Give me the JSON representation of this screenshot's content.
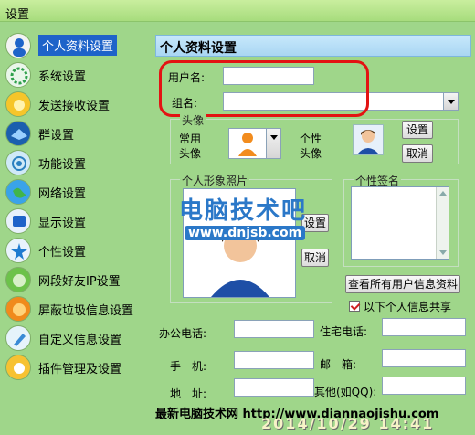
{
  "window": {
    "title": "设置"
  },
  "sidebar": {
    "items": [
      {
        "label": "个人资料设置",
        "icon": "person-icon",
        "active": true
      },
      {
        "label": "系统设置",
        "icon": "system-gear-icon"
      },
      {
        "label": "发送接收设置",
        "icon": "send-receive-icon"
      },
      {
        "label": "群设置",
        "icon": "group-icon"
      },
      {
        "label": "功能设置",
        "icon": "function-icon"
      },
      {
        "label": "网络设置",
        "icon": "globe-icon"
      },
      {
        "label": "显示设置",
        "icon": "display-icon"
      },
      {
        "label": "个性设置",
        "icon": "personality-icon"
      },
      {
        "label": "网段好友IP设置",
        "icon": "network-friends-icon"
      },
      {
        "label": "屏蔽垃圾信息设置",
        "icon": "block-spam-icon"
      },
      {
        "label": "自定义信息设置",
        "icon": "custom-info-icon"
      },
      {
        "label": "插件管理及设置",
        "icon": "plugin-icon"
      }
    ]
  },
  "panel": {
    "title": "个人资料设置",
    "username_label": "用户名:",
    "username_value": "",
    "groupname_label": "组名:",
    "groupname_value": "",
    "avatar_group_title": "头像",
    "common_avatar_label": "常用\n头像",
    "custom_avatar_label": "个性\n头像",
    "avatar_set_button": "设置",
    "avatar_cancel_button": "取消",
    "photo_group_title": "个人形象照片",
    "photo_set_button": "设置",
    "photo_cancel_button": "取消",
    "signature_group_title": "个性签名",
    "view_all_button": "查看所有用户信息资料",
    "share_checkbox_label": "以下个人信息共享",
    "share_checked": true,
    "office_phone_label": "办公电话:",
    "home_phone_label": "住宅电话:",
    "mobile_label": "手　机:",
    "email_label": "邮　箱:",
    "address_label": "地　址:",
    "other_label": "其他(如QQ):"
  },
  "watermark": {
    "cn": "电脑技术吧",
    "url": "www.dnjsb.com"
  },
  "footer": {
    "text": "最新电脑技术网 http://www.diannaojishu.com",
    "stamp": "2014/10/29 14:41"
  },
  "colors": {
    "background": "#9fd68a",
    "header": "#a9d6f3",
    "active": "#1e63c9",
    "highlight": "#e31313"
  }
}
